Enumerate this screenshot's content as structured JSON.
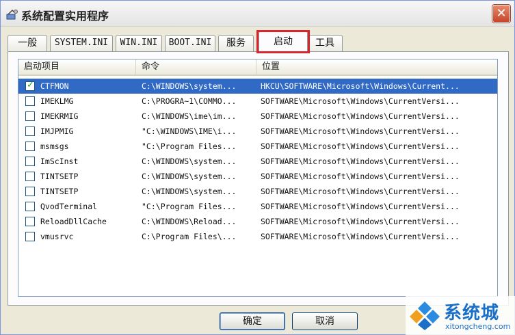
{
  "window": {
    "title": "系统配置实用程序",
    "close_label": "✕"
  },
  "tabs": [
    {
      "label": "一般"
    },
    {
      "label": "SYSTEM.INI"
    },
    {
      "label": "WIN.INI"
    },
    {
      "label": "BOOT.INI"
    },
    {
      "label": "服务"
    },
    {
      "label": "启动",
      "active": true
    },
    {
      "label": "工具"
    }
  ],
  "list": {
    "columns": [
      "启动项目",
      "命令",
      "位置"
    ],
    "rows": [
      {
        "name": "CTFMON",
        "command": "C:\\WINDOWS\\system...",
        "location": "HKCU\\SOFTWARE\\Microsoft\\Windows\\Current...",
        "checked": true,
        "selected": true
      },
      {
        "name": "IMEKLMG",
        "command": "C:\\PROGRA~1\\COMMO...",
        "location": "SOFTWARE\\Microsoft\\Windows\\CurrentVersi...",
        "checked": false
      },
      {
        "name": "IMEKRMIG",
        "command": "C:\\WINDOWS\\ime\\im...",
        "location": "SOFTWARE\\Microsoft\\Windows\\CurrentVersi...",
        "checked": false
      },
      {
        "name": "IMJPMIG",
        "command": "\"C:\\WINDOWS\\IME\\i...",
        "location": "SOFTWARE\\Microsoft\\Windows\\CurrentVersi...",
        "checked": false
      },
      {
        "name": "msmsgs",
        "command": "\"C:\\Program Files...",
        "location": "SOFTWARE\\Microsoft\\Windows\\CurrentVersi...",
        "checked": false
      },
      {
        "name": "ImScInst",
        "command": "C:\\WINDOWS\\system...",
        "location": "SOFTWARE\\Microsoft\\Windows\\CurrentVersi...",
        "checked": false
      },
      {
        "name": "TINTSETP",
        "command": "C:\\WINDOWS\\system...",
        "location": "SOFTWARE\\Microsoft\\Windows\\CurrentVersi...",
        "checked": false
      },
      {
        "name": "TINTSETP",
        "command": "C:\\WINDOWS\\system...",
        "location": "SOFTWARE\\Microsoft\\Windows\\CurrentVersi...",
        "checked": false
      },
      {
        "name": "QvodTerminal",
        "command": "\"C:\\Program Files...",
        "location": "SOFTWARE\\Microsoft\\Windows\\CurrentVersi...",
        "checked": false
      },
      {
        "name": "ReloadDllCache",
        "command": "C:\\WINDOWS\\Reload...",
        "location": "SOFTWARE\\Microsoft\\Windows\\CurrentVersi...",
        "checked": false
      },
      {
        "name": "vmusrvc",
        "command": "C:\\Program Files\\...",
        "location": "SOFTWARE\\Microsoft\\Windows\\CurrentVersi...",
        "checked": false
      }
    ]
  },
  "buttons": {
    "ok": "确定",
    "cancel": "取消"
  },
  "watermark": {
    "brand": "系统城",
    "url": "xitongcheng.com"
  },
  "colors": {
    "selection": "#316ac5",
    "tab_highlight": "#d8242c",
    "brand_blue": "#1a6fc9"
  }
}
